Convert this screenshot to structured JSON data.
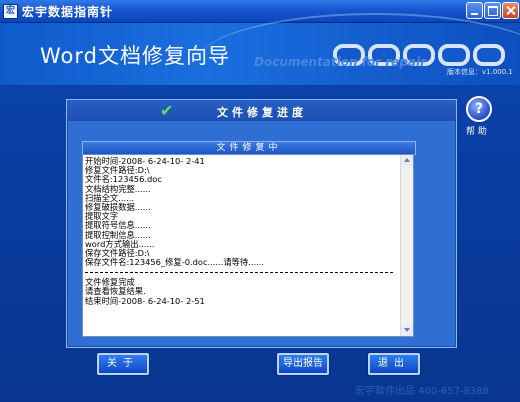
{
  "window": {
    "title": "宏宇数据指南针"
  },
  "banner": {
    "title": "Word文档修复向导",
    "subtitle": "Documentation for repair",
    "version": "版本信息：v1.000.1"
  },
  "help": {
    "label": "帮 助"
  },
  "panel": {
    "title": "文件修复进度",
    "inner_title": "文件修复中"
  },
  "log": {
    "lines_part1": [
      "开始时间-2008- 6-24-10- 2-41",
      "修复文件路径:D:\\",
      "文件名:123456.doc",
      "文档结构完整......",
      "扫描全文......",
      "修复破损数据......",
      "提取文字",
      "提取符号信息......",
      "提取控制信息......",
      "word方式输出......",
      "保存文件路径:D:\\",
      "保存文件名:123456_修复-0.doc......请等待......"
    ],
    "lines_part2": [
      "文件修复完成",
      "请查看恢复结果.",
      "结束时间-2008- 6-24-10- 2-51"
    ]
  },
  "buttons": {
    "about": "关于",
    "export": "导出报告",
    "exit": "退出"
  },
  "footer": {
    "text": "宏宇软件出品  400-657-8388"
  }
}
